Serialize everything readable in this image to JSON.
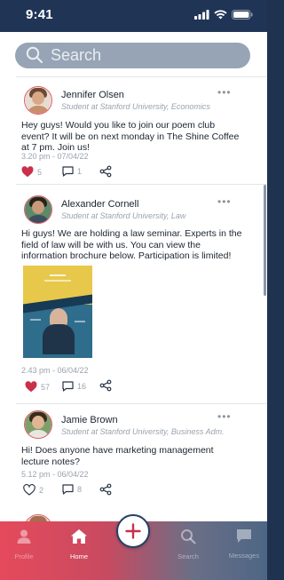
{
  "status": {
    "time": "9:41"
  },
  "search": {
    "placeholder": "Search"
  },
  "posts": [
    {
      "author": "Jennifer Olsen",
      "role": "Student at Stanford University, Economics",
      "text": "Hey guys! Would you like to join our poem club event? It will be on next monday in The Shine Coffee at 7 pm. Join us!",
      "date": "3.20 pm - 07/04/22",
      "likes": "5",
      "comments": "1",
      "liked": true
    },
    {
      "author": "Alexander Cornell",
      "role": "Student at Stanford University, Law",
      "text": "Hi guys! We are holding a law seminar. Experts in the field of law will be with us. You can view the information brochure below. Participation is limited!",
      "date": "2.43 pm - 06/04/22",
      "likes": "57",
      "comments": "16",
      "liked": true
    },
    {
      "author": "Jamie Brown",
      "role": "Student at Stanford University, Business Adm.",
      "text": "Hi! Does anyone have marketing management lecture notes?",
      "date": "5.12 pm - 06/04/22",
      "likes": "2",
      "comments": "8",
      "liked": false
    }
  ],
  "nav": {
    "profile": "Profile",
    "home": "Home",
    "search": "Search",
    "messages": "Messages"
  },
  "colors": {
    "accent": "#e54a5c",
    "navy": "#203456",
    "muted": "#9aa3ad"
  }
}
